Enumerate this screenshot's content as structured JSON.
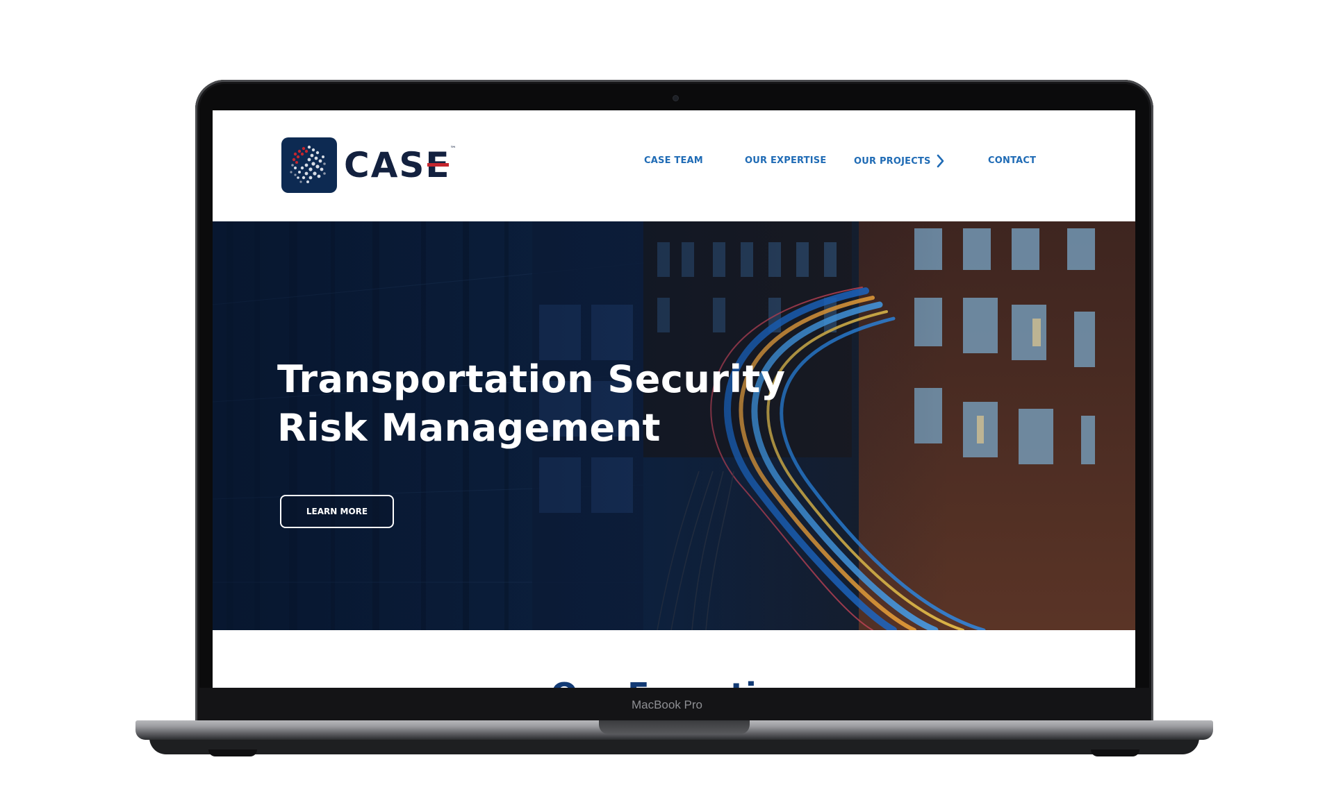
{
  "device": {
    "model_label": "MacBook Pro"
  },
  "header": {
    "logo_text": "CAS",
    "logo_accent_letter": "E",
    "logo_trademark": "™",
    "nav": [
      {
        "label": "CASE TEAM"
      },
      {
        "label": "OUR EXPERTISE"
      },
      {
        "label": "OUR PROJECTS",
        "icon": "chevron-right-icon"
      },
      {
        "label": "CONTACT"
      }
    ]
  },
  "hero": {
    "title_line1": "Transportation Security",
    "title_line2": "Risk Management",
    "button_label": "LEARN MORE"
  },
  "section": {
    "heading": "Our Expertise"
  },
  "colors": {
    "nav_blue": "#1f6bb5",
    "logo_navy": "#0d2a52",
    "logo_red": "#c4262e",
    "heading_navy": "#123a74"
  }
}
